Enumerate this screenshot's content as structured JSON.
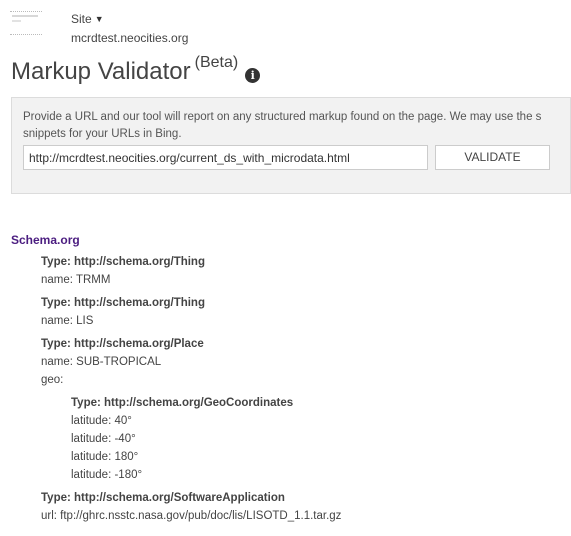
{
  "header": {
    "site_label": "Site",
    "site_url": "mcrdtest.neocities.org"
  },
  "title": {
    "main": "Markup Validator",
    "beta": "(Beta)",
    "info_icon": "info-icon"
  },
  "panel": {
    "description_line1": "Provide a URL and our tool will report on any structured markup found on the page. We may use the s",
    "description_line2": "snippets for your URLs in Bing.",
    "url_value": "http://mcrdtest.neocities.org/current_ds_with_microdata.html",
    "validate_label": "VALIDATE"
  },
  "results": {
    "heading": "Schema.org",
    "items": [
      {
        "type": "Type: http://schema.org/Thing",
        "props": [
          "name: TRMM"
        ]
      },
      {
        "type": "Type: http://schema.org/Thing",
        "props": [
          "name: LIS"
        ]
      },
      {
        "type": "Type: http://schema.org/Place",
        "props": [
          "name: SUB-TROPICAL",
          "geo:"
        ]
      },
      {
        "type": "Type: http://schema.org/GeoCoordinates",
        "props": [
          "latitude: 40°",
          "latitude: -40°",
          "latitude: 180°",
          "latitude: -180°"
        ]
      },
      {
        "type": "Type: http://schema.org/SoftwareApplication",
        "props": [
          "url: ftp://ghrc.nsstc.nasa.gov/pub/doc/lis/LISOTD_1.1.tar.gz"
        ]
      }
    ]
  },
  "colors": {
    "heading_purple": "#4b1d80",
    "panel_bg": "#f2f2f2"
  }
}
